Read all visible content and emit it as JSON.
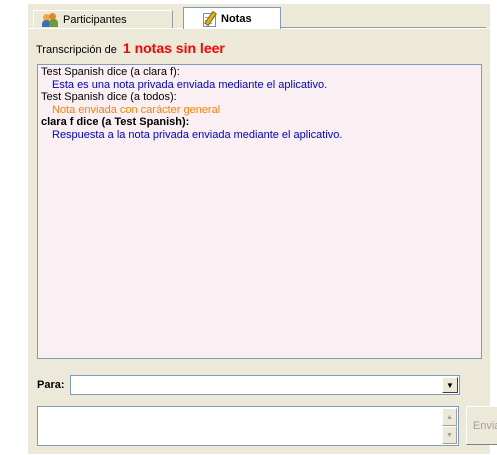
{
  "tabs": [
    {
      "label": "Participantes",
      "icon": "participants-icon",
      "active": false
    },
    {
      "label": "Notas",
      "icon": "notes-icon",
      "active": true
    }
  ],
  "transcript": {
    "prefix": "Transcripción de",
    "unread": "1 notas sin leer",
    "unread_color": "#ff0000",
    "entries": [
      {
        "header": "Test Spanish dice (a clara f):",
        "header_bold": false,
        "message": "Esta es una nota privada enviada mediante el aplicativo.",
        "message_color": "#0000cc"
      },
      {
        "header": "Test Spanish dice (a todos):",
        "header_bold": false,
        "message": "Nota enviada con carácter general",
        "message_color": "#ff8000"
      },
      {
        "header": "clara f dice (a Test Spanish):",
        "header_bold": true,
        "message": "Respuesta a la nota privada enviada mediante el aplicativo.",
        "message_color": "#0000cc"
      }
    ]
  },
  "recipient": {
    "label": "Para:",
    "value": ""
  },
  "note_input": {
    "value": ""
  },
  "send_button": {
    "label": "Enviar",
    "enabled": false
  }
}
